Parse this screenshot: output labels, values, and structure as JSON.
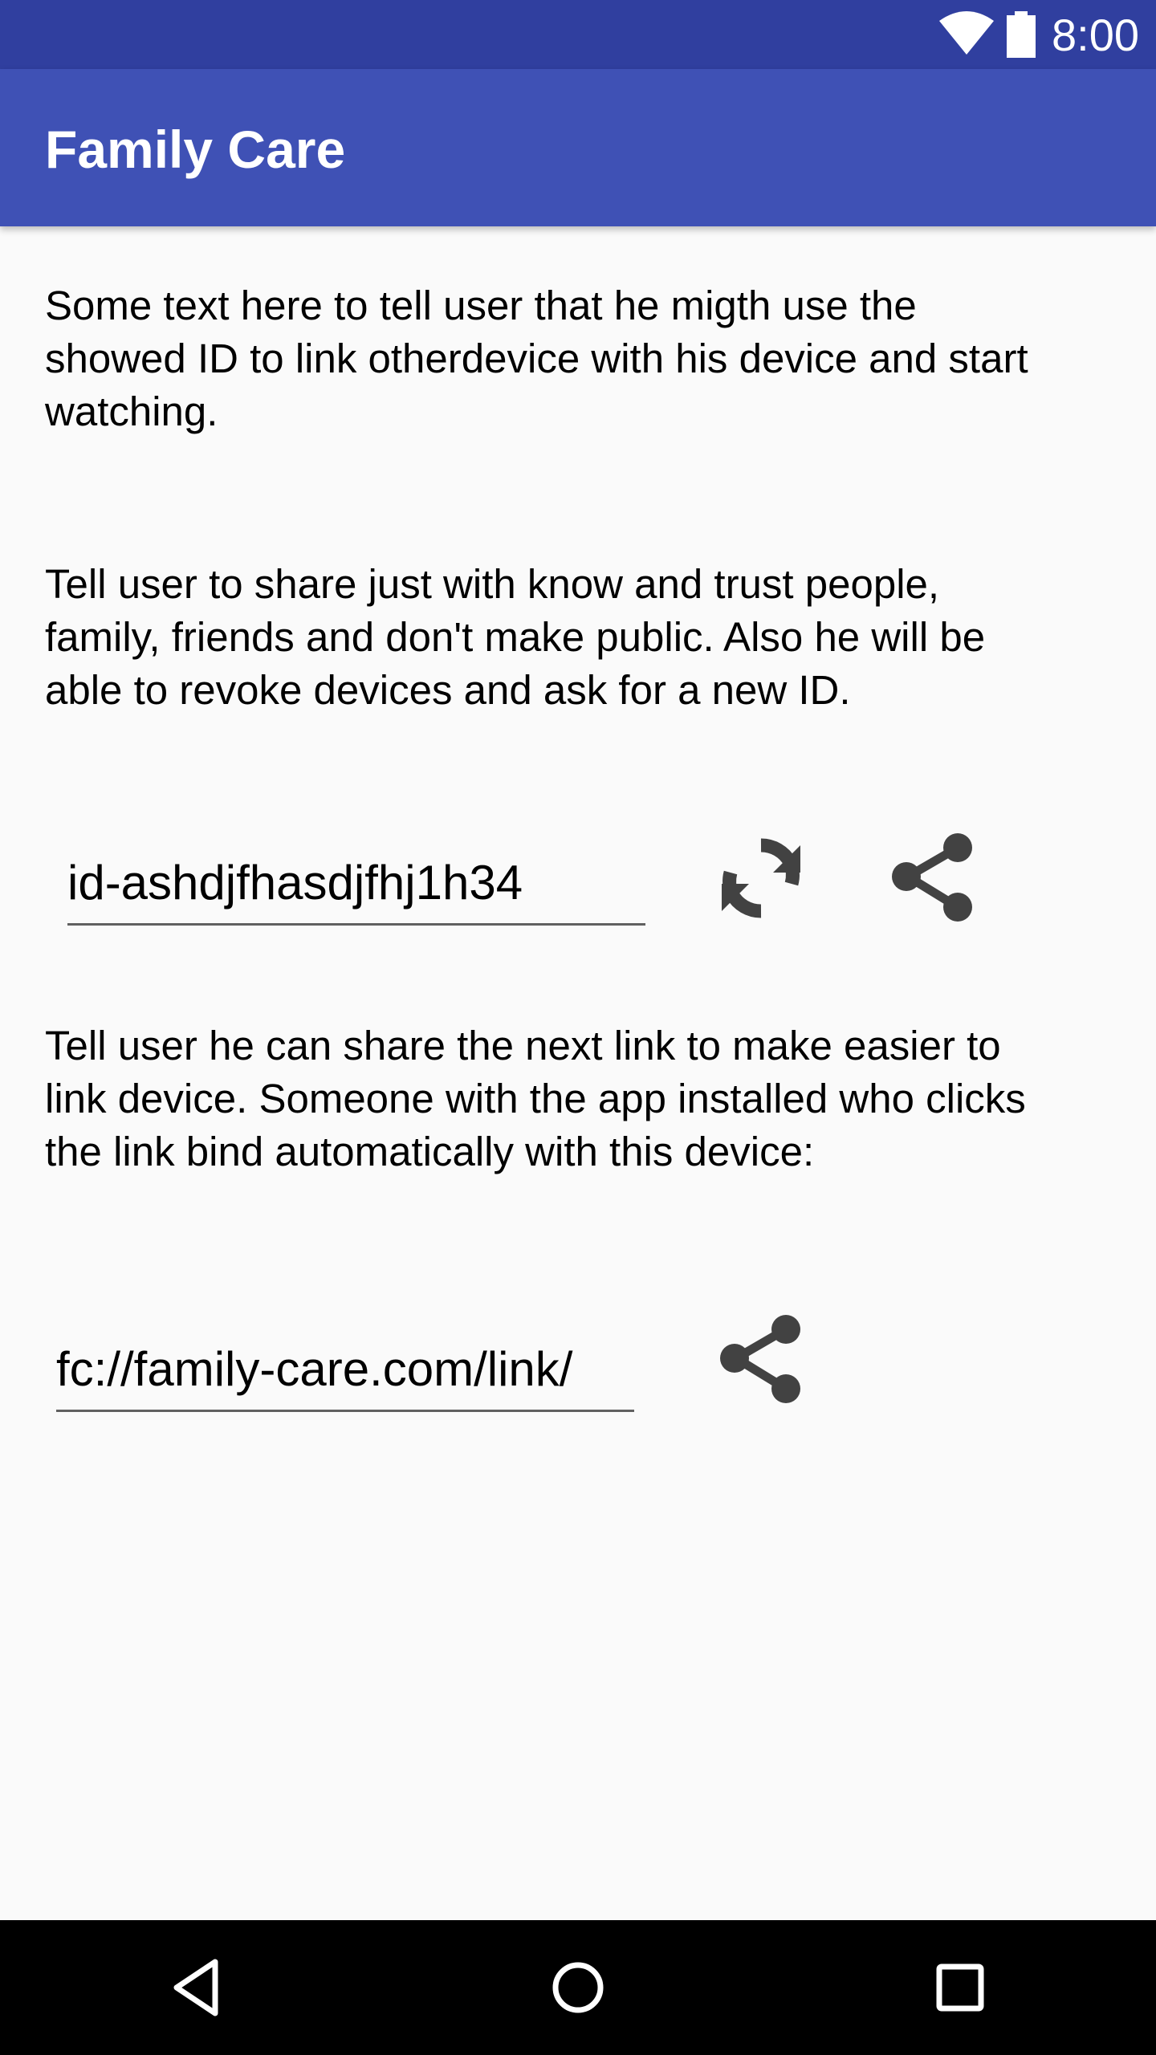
{
  "status_bar": {
    "time": "8:00",
    "icons": [
      "wifi-icon",
      "battery-icon"
    ]
  },
  "app_bar": {
    "title": "Family Care"
  },
  "content": {
    "intro_text": "Some text here to tell user that he migth use the showed ID to link otherdevice with his device and start watching.",
    "warning_text": "Tell user to share just with know and trust people, family, friends and don't make public. Also he will be able to revoke devices and ask for a new ID.",
    "device_id": "id-ashdjfhasdjfhj1h34",
    "link_info_text": "Tell user he can share the next link to make easier to link device. Someone with the app installed who clicks the link bind automatically with this device:",
    "share_link": "fc://family-care.com/link/"
  },
  "icons": {
    "refresh": "refresh-icon",
    "share": "share-icon"
  },
  "nav_bar": {
    "buttons": [
      "back",
      "home",
      "recents"
    ]
  },
  "colors": {
    "status_bar": "#303f9f",
    "app_bar": "#3f51b5",
    "icon": "#424242",
    "background": "#fafafa"
  }
}
